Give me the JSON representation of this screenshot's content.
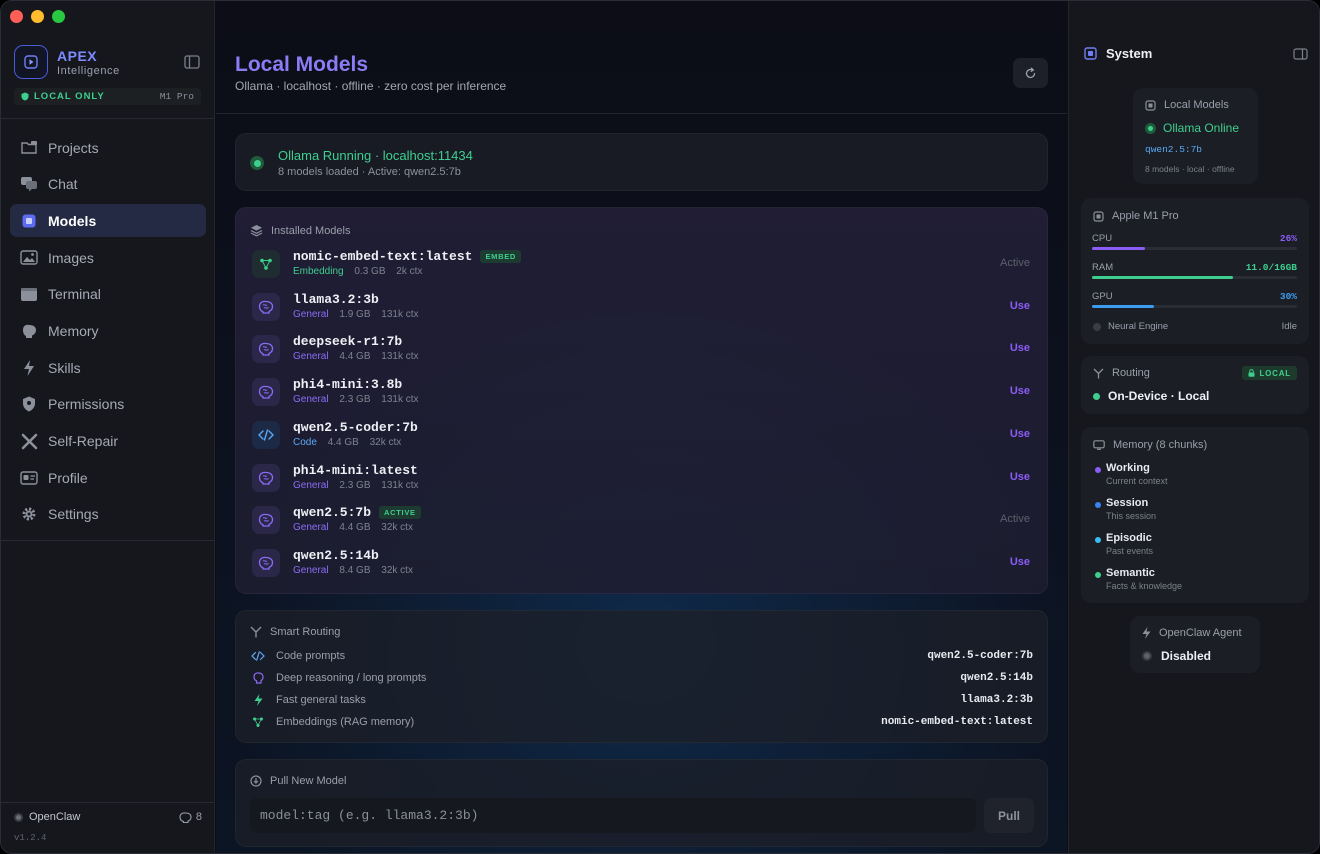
{
  "window": {
    "traffic_lights": [
      "#ff5f57",
      "#febc2e",
      "#28c840"
    ]
  },
  "brand": {
    "name": "APEX",
    "subtitle": "Intelligence",
    "badge": "LOCAL ONLY",
    "chip": "M1 Pro"
  },
  "nav": [
    {
      "label": "Projects",
      "icon": "folder-icon",
      "active": false
    },
    {
      "label": "Chat",
      "icon": "chat-icon",
      "active": false
    },
    {
      "label": "Models",
      "icon": "cpu-icon",
      "active": true
    },
    {
      "label": "Images",
      "icon": "image-icon",
      "active": false
    },
    {
      "label": "Terminal",
      "icon": "terminal-icon",
      "active": false
    },
    {
      "label": "Memory",
      "icon": "brain-icon",
      "active": false
    },
    {
      "label": "Skills",
      "icon": "bolt-icon",
      "active": false
    },
    {
      "label": "Permissions",
      "icon": "shield-icon",
      "active": false
    },
    {
      "label": "Self-Repair",
      "icon": "wrench-icon",
      "active": false
    },
    {
      "label": "Profile",
      "icon": "id-card-icon",
      "active": false
    },
    {
      "label": "Settings",
      "icon": "gear-icon",
      "active": false
    }
  ],
  "footer": {
    "agent": "OpenClaw",
    "count": "8",
    "version": "v1.2.4"
  },
  "page": {
    "title": "Local Models",
    "subtitle": "Ollama · localhost · offline · zero cost per inference"
  },
  "status": {
    "title": "Ollama Running · localhost:11434",
    "subtitle": "8 models loaded · Active: qwen2.5:7b"
  },
  "installed": {
    "heading": "Installed Models",
    "models": [
      {
        "name": "nomic-embed-text:latest",
        "tag": "EMBED",
        "category": "Embedding",
        "size": "0.3 GB",
        "ctx": "2k ctx",
        "action": "Active",
        "kind": "embed"
      },
      {
        "name": "llama3.2:3b",
        "tag": "",
        "category": "General",
        "size": "1.9 GB",
        "ctx": "131k ctx",
        "action": "Use",
        "kind": "general"
      },
      {
        "name": "deepseek-r1:7b",
        "tag": "",
        "category": "General",
        "size": "4.4 GB",
        "ctx": "131k ctx",
        "action": "Use",
        "kind": "general"
      },
      {
        "name": "phi4-mini:3.8b",
        "tag": "",
        "category": "General",
        "size": "2.3 GB",
        "ctx": "131k ctx",
        "action": "Use",
        "kind": "general"
      },
      {
        "name": "qwen2.5-coder:7b",
        "tag": "",
        "category": "Code",
        "size": "4.4 GB",
        "ctx": "32k ctx",
        "action": "Use",
        "kind": "code"
      },
      {
        "name": "phi4-mini:latest",
        "tag": "",
        "category": "General",
        "size": "2.3 GB",
        "ctx": "131k ctx",
        "action": "Use",
        "kind": "general"
      },
      {
        "name": "qwen2.5:7b",
        "tag": "ACTIVE",
        "category": "General",
        "size": "4.4 GB",
        "ctx": "32k ctx",
        "action": "Active",
        "kind": "general"
      },
      {
        "name": "qwen2.5:14b",
        "tag": "",
        "category": "General",
        "size": "8.4 GB",
        "ctx": "32k ctx",
        "action": "Use",
        "kind": "general"
      }
    ]
  },
  "routing": {
    "heading": "Smart Routing",
    "rules": [
      {
        "label": "Code prompts",
        "model": "qwen2.5-coder:7b",
        "icon": "code-icon"
      },
      {
        "label": "Deep reasoning / long prompts",
        "model": "qwen2.5:14b",
        "icon": "brain-icon"
      },
      {
        "label": "Fast general tasks",
        "model": "llama3.2:3b",
        "icon": "bolt-icon"
      },
      {
        "label": "Embeddings (RAG memory)",
        "model": "nomic-embed-text:latest",
        "icon": "network-icon"
      }
    ]
  },
  "pull": {
    "heading": "Pull New Model",
    "placeholder": "model:tag (e.g. llama3.2:3b)",
    "button": "Pull"
  },
  "system": {
    "title": "System",
    "local_models": {
      "heading": "Local Models",
      "status": "Ollama Online",
      "model": "qwen2.5:7b",
      "meta": "8 models · local · offline"
    },
    "hardware": {
      "heading": "Apple M1 Pro",
      "cpu": {
        "label": "CPU",
        "value": "26%",
        "fraction": 0.26,
        "color": "#8b5cf6"
      },
      "ram": {
        "label": "RAM",
        "value": "11.0/16GB",
        "fraction": 0.69,
        "color": "#3ecf8e"
      },
      "gpu": {
        "label": "GPU",
        "value": "30%",
        "fraction": 0.3,
        "color": "#3b9cf0"
      },
      "neural": {
        "label": "Neural Engine",
        "value": "Idle"
      }
    },
    "routing": {
      "heading": "Routing",
      "badge": "LOCAL",
      "value": "On-Device · Local"
    },
    "memory": {
      "heading": "Memory (8 chunks)",
      "items": [
        {
          "title": "Working",
          "sub": "Current context",
          "color": "#8b5cf6"
        },
        {
          "title": "Session",
          "sub": "This session",
          "color": "#3b82f6"
        },
        {
          "title": "Episodic",
          "sub": "Past events",
          "color": "#38bdf8"
        },
        {
          "title": "Semantic",
          "sub": "Facts & knowledge",
          "color": "#3ecf8e"
        }
      ]
    },
    "agent": {
      "heading": "OpenClaw Agent",
      "status": "Disabled"
    }
  }
}
